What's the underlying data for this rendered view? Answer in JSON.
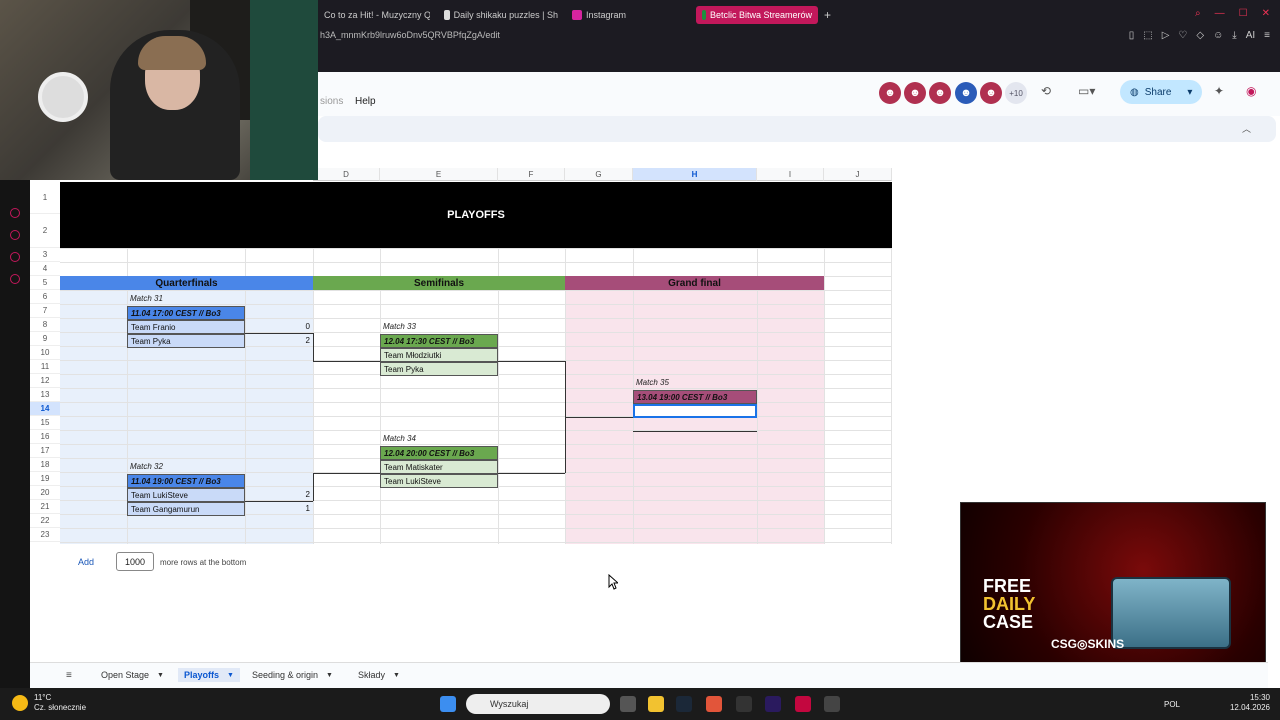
{
  "browser": {
    "tabs": [
      {
        "label": "Co to za Hit! - Muzyczny Q"
      },
      {
        "label": "Daily shikaku puzzles | Sh"
      },
      {
        "label": "Instagram"
      },
      {
        "label": "Betclic Bitwa Streamerów"
      }
    ],
    "new_tab": "+",
    "url": "h3A_mnmKrb9lruw6oDnv5QRVBPfqZgA/edit",
    "ai_label": "AI"
  },
  "docs": {
    "menu_partial": "sions",
    "menu_help": "Help",
    "collaborators_more": "+10",
    "share_label": "Share"
  },
  "columns": [
    "D",
    "E",
    "F",
    "G",
    "H",
    "I",
    "J"
  ],
  "rows": [
    "1",
    "2",
    "3",
    "4",
    "5",
    "6",
    "7",
    "8",
    "9",
    "10",
    "11",
    "12",
    "13",
    "14",
    "15",
    "16",
    "17",
    "18",
    "19",
    "20",
    "21",
    "22",
    "23"
  ],
  "sheet": {
    "title": "PLAYOFFS",
    "stages": {
      "quarterfinals": "Quarterfinals",
      "semifinals": "Semifinals",
      "grand_final": "Grand final"
    },
    "colors": {
      "quarter_header": "#4a86e8",
      "quarter_bg": "#e8f0fb",
      "quarter_cell": "#c9daf8",
      "semi_header": "#6aa84f",
      "semi_cell": "#d9ead3",
      "final_header": "#a64d79",
      "final_bg": "#f9e4ec"
    },
    "matches": {
      "m31": {
        "label": "Match 31",
        "date": "11.04 17:00 CEST // Bo3",
        "team1": "Team Franio",
        "score1": "0",
        "team2": "Team Pyka",
        "score2": "2"
      },
      "m32": {
        "label": "Match 32",
        "date": "11.04 19:00 CEST // Bo3",
        "team1": "Team LukiSteve",
        "score1": "2",
        "team2": "Team Gangamurun",
        "score2": "1"
      },
      "m33": {
        "label": "Match 33",
        "date": "12.04 17:30 CEST // Bo3",
        "team1": "Team Młodziutki",
        "team2": "Team Pyka"
      },
      "m34": {
        "label": "Match 34",
        "date": "12.04 20:00 CEST // Bo3",
        "team1": "Team Matiskater",
        "team2": "Team LukiSteve"
      },
      "m35": {
        "label": "Match 35",
        "date": "13.04 19:00 CEST // Bo3"
      }
    },
    "add_rows": {
      "button": "Add",
      "count": "1000",
      "suffix": "more rows at the bottom"
    }
  },
  "sheet_tabs": [
    {
      "label": "Open Stage"
    },
    {
      "label": "Playoffs"
    },
    {
      "label": "Seeding & origin"
    },
    {
      "label": "Składy"
    }
  ],
  "ad": {
    "line1": "FREE",
    "line2": "DAILY",
    "line3": "CASE",
    "brand": "CSG◎SKINS"
  },
  "taskbar": {
    "temp": "11°C",
    "weather": "Cz. słonecznie",
    "search_placeholder": "Wyszukaj",
    "lang": "POL",
    "time": "15:30",
    "date": "12.04.2026"
  }
}
